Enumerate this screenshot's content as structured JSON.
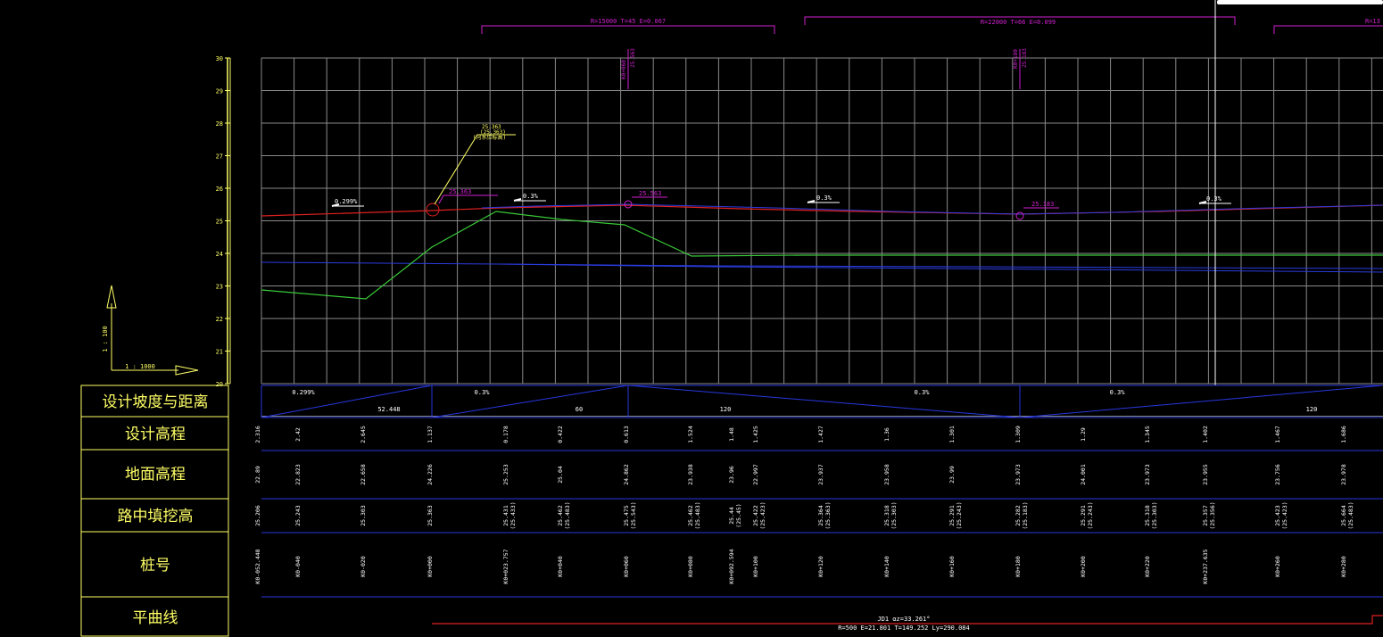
{
  "colors": {
    "background": "#000000",
    "grid": "#8a8a8a",
    "design_line": "#e02020",
    "ground_line": "#38c838",
    "baseline": "#2b3ce0",
    "vertical_curve": "#d020d0",
    "yellow": "#ffff66",
    "table_line": "#2838e0",
    "white": "#ffffff"
  },
  "axis": {
    "y_ticks": [
      "30",
      "29",
      "28",
      "27",
      "26",
      "25",
      "24",
      "23",
      "22",
      "21",
      "20"
    ]
  },
  "scale": {
    "vertical": "1 : 100",
    "horizontal": "1 : 1000"
  },
  "vertical_curves": [
    {
      "label": "R=15000  T=45  E=0.067",
      "station": "K0+060",
      "elevation": "25.563"
    },
    {
      "label": "R=22000  T=66  E=0.099",
      "station": "K0+180",
      "elevation": "25.183"
    },
    {
      "label": "R=13"
    }
  ],
  "profile_annotations": {
    "circle_a": "25.363",
    "leader_a": [
      "25.363",
      "(25.363)",
      "(河水位标高)"
    ],
    "circle_b": "25.563",
    "circle_c": "25.183",
    "grade_marks": [
      "0.299%",
      "0.3%",
      "0.3%",
      "0.3%"
    ]
  },
  "table": {
    "row_labels": [
      "设计坡度与距离",
      "设计高程",
      "地面高程",
      "路中填挖高",
      "桩号",
      "平曲线"
    ],
    "grades": [
      {
        "grade": "0.299%",
        "length": "52.448"
      },
      {
        "grade": "0.3%",
        "length": "60"
      },
      {
        "grade": "0.3%",
        "length": "120"
      },
      {
        "grade": "0.3%",
        "length": "120"
      }
    ],
    "columns": [
      {
        "r1": "2.316",
        "r2": "22.89",
        "r3": "25.206",
        "r3b": "",
        "sta": "K0-052.448"
      },
      {
        "r1": "2.42",
        "r2": "22.823",
        "r3": "25.243",
        "r3b": "",
        "sta": "K0-040"
      },
      {
        "r1": "2.645",
        "r2": "22.658",
        "r3": "25.303",
        "r3b": "",
        "sta": "K0-020"
      },
      {
        "r1": "1.137",
        "r2": "24.226",
        "r3": "25.363",
        "r3b": "",
        "sta": "K0+000"
      },
      {
        "r1": "0.178",
        "r2": "25.253",
        "r3": "25.431",
        "r3b": "(25.433)",
        "sta": "K0+023.757"
      },
      {
        "r1": "0.422",
        "r2": "25.04",
        "r3": "25.462",
        "r3b": "(25.483)",
        "sta": "K0+040"
      },
      {
        "r1": "0.613",
        "r2": "24.862",
        "r3": "25.475",
        "r3b": "(25.543)",
        "sta": "K0+060"
      },
      {
        "r1": "1.524",
        "r2": "23.938",
        "r3": "25.462",
        "r3b": "(25.483)",
        "sta": "K0+080"
      },
      {
        "r1": "1.48",
        "r2": "23.96",
        "r3": "25.44",
        "r3b": "(25.45)",
        "sta": "K0+092.594"
      },
      {
        "r1": "1.425",
        "r2": "22.997",
        "r3": "25.422",
        "r3b": "(25.423)",
        "sta": "K0+100"
      },
      {
        "r1": "1.427",
        "r2": "23.937",
        "r3": "25.364",
        "r3b": "(25.363)",
        "sta": "K0+120"
      },
      {
        "r1": "1.36",
        "r2": "23.958",
        "r3": "25.318",
        "r3b": "(25.303)",
        "sta": "K0+140"
      },
      {
        "r1": "1.301",
        "r2": "23.99",
        "r3": "25.291",
        "r3b": "(25.243)",
        "sta": "K0+160"
      },
      {
        "r1": "1.309",
        "r2": "23.973",
        "r3": "25.282",
        "r3b": "(25.183)",
        "sta": "K0+180"
      },
      {
        "r1": "1.29",
        "r2": "24.001",
        "r3": "25.291",
        "r3b": "(25.243)",
        "sta": "K0+200"
      },
      {
        "r1": "1.345",
        "r2": "23.973",
        "r3": "25.318",
        "r3b": "(25.303)",
        "sta": "K0+220"
      },
      {
        "r1": "1.402",
        "r2": "23.955",
        "r3": "25.357",
        "r3b": "(25.356)",
        "sta": "K0+237.635"
      },
      {
        "r1": "1.467",
        "r2": "23.756",
        "r3": "25.423",
        "r3b": "(25.423)",
        "sta": "K0+260"
      },
      {
        "r1": "1.686",
        "r2": "23.978",
        "r3": "25.664",
        "r3b": "(25.483)",
        "sta": "K0+280"
      }
    ],
    "curve_line1": "JD1  αz=33.261°",
    "curve_line2": "R=500  E=21.801  T=149.252  Ly=290.084"
  }
}
